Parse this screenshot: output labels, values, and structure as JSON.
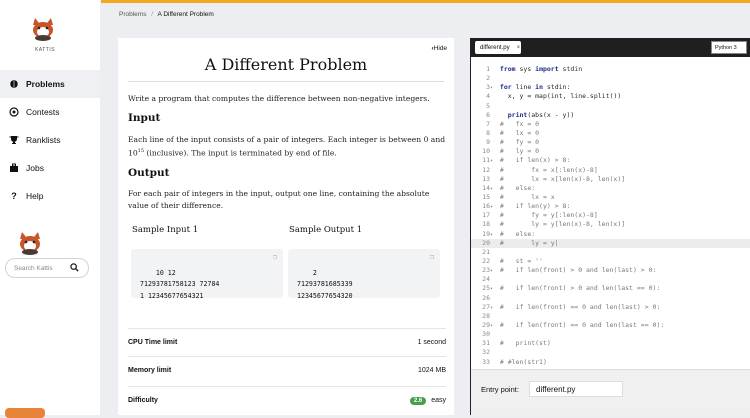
{
  "sidebar": {
    "logo_text": "KATTIS",
    "items": [
      {
        "label": "Problems",
        "icon": "problems-icon"
      },
      {
        "label": "Contests",
        "icon": "contests-icon"
      },
      {
        "label": "Ranklists",
        "icon": "trophy-icon"
      },
      {
        "label": "Jobs",
        "icon": "jobs-icon"
      },
      {
        "label": "Help",
        "icon": "help-icon"
      }
    ],
    "search_placeholder": "Search Kattis"
  },
  "breadcrumb": {
    "root": "Problems",
    "sep": "/",
    "current": "A Different Problem"
  },
  "problem": {
    "hide_label": "Hide",
    "title": "A Different Problem",
    "intro": "Write a program that computes the difference between non-negative integers.",
    "input_heading": "Input",
    "input_text_a": "Each line of the input consists of a pair of integers. Each integer is between 0 and",
    "input_text_b_base": "10",
    "input_text_b_sup": "15",
    "input_text_b_rest": " (inclusive). The input is terminated by end of file.",
    "output_heading": "Output",
    "output_text": "For each pair of integers in the input, output one line, containing the absolute value of their difference.",
    "sample_input_label": "Sample Input 1",
    "sample_output_label": "Sample Output 1",
    "sample_input": "10 12\n71293781758123 72784\n1 12345677654321",
    "sample_output": "2\n71293781685339\n12345677654320",
    "cpu_label": "CPU Time limit",
    "cpu_value": "1 second",
    "mem_label": "Memory limit",
    "mem_value": "1024 MB",
    "diff_label": "Difficulty",
    "diff_badge": "2.6",
    "diff_value": "easy"
  },
  "editor": {
    "tab_label": "different.py",
    "tab_close": "×",
    "language": "Python 3",
    "entry_label": "Entry point:",
    "entry_value": "different.py"
  },
  "colors": {
    "accent": "#f5a623",
    "badge": "#4aa04a"
  }
}
